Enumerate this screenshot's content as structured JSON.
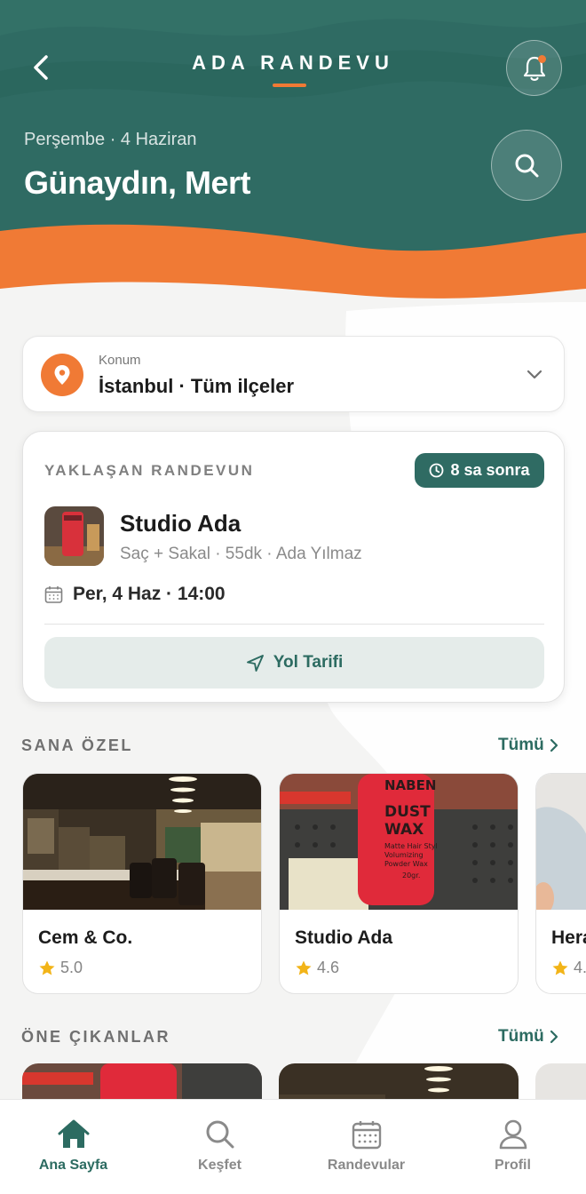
{
  "header": {
    "app_title": "ADA RANDEVU",
    "date_line": "Perşembe · 4 Haziran",
    "greeting": "Günaydın, Mert"
  },
  "colors": {
    "teal": "#2f6b63",
    "orange": "#f07a35",
    "background": "#f4f4f3"
  },
  "location": {
    "label": "Konum",
    "value": "İstanbul · Tüm ilçeler"
  },
  "upcoming": {
    "heading": "YAKLAŞAN RANDEVUN",
    "badge": "8 sa sonra",
    "shop_name": "Studio Ada",
    "details": "Saç + Sakal · 55dk · Ada Yılmaz",
    "datetime": "Per, 4 Haz · 14:00",
    "route_button": "Yol Tarifi"
  },
  "for_you": {
    "title": "SANA ÖZEL",
    "see_all": "Tümü",
    "shops": [
      {
        "name": "Cem & Co.",
        "rating": "5.0",
        "image": "barbershop-interior"
      },
      {
        "name": "Studio Ada",
        "rating": "4.6",
        "image": "dust-wax-product"
      },
      {
        "name": "Hera",
        "rating": "4.",
        "image": "person-portrait"
      }
    ]
  },
  "featured": {
    "title": "ÖNE ÇIKANLAR",
    "see_all": "Tümü"
  },
  "product_label": {
    "brand": "NABEN",
    "name_line1": "DUST",
    "name_line2": "WAX",
    "sub1": "Matte Hair Styl",
    "sub2": "Volumizing",
    "sub3": "Powder Wax",
    "weight": "20gr."
  },
  "bottom_nav": [
    {
      "label": "Ana Sayfa",
      "icon": "home-icon",
      "active": true
    },
    {
      "label": "Keşfet",
      "icon": "search-icon",
      "active": false
    },
    {
      "label": "Randevular",
      "icon": "calendar-icon",
      "active": false
    },
    {
      "label": "Profil",
      "icon": "user-icon",
      "active": false
    }
  ]
}
